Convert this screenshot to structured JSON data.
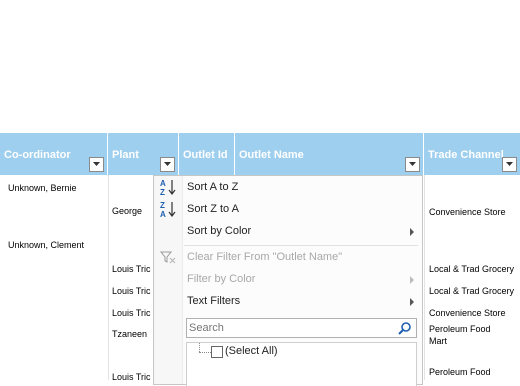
{
  "header": {
    "columns": [
      {
        "label": "Co-ordinator"
      },
      {
        "label": "Plant"
      },
      {
        "label": "Outlet Id"
      },
      {
        "label": "Outlet Name"
      },
      {
        "label": "Trade Channel"
      }
    ]
  },
  "rows": {
    "r1_coord": "Unknown, Bernie",
    "r2_plant": "George",
    "r2_channel": "Convenience Store",
    "r3_coord": "Unknown, Clement",
    "r4_plant": "Louis Tric",
    "r4_channel": "Local & Trad Grocery",
    "r5_plant": "Louis Tric",
    "r5_channel": "Local & Trad Grocery",
    "r6_plant": "Louis Tric",
    "r6_channel": "Convenience Store",
    "r7_plant": "Tzaneen",
    "r7_channel_l1": "Peroleum Food",
    "r7_channel_l2": "Mart",
    "r8_plant": "Louis Tric",
    "r8_channel": "Peroleum Food"
  },
  "filter_menu": {
    "sort_az": "Sort A to Z",
    "sort_za": "Sort Z to A",
    "sort_color": "Sort by Color",
    "clear_filter": "Clear Filter From \"Outlet Name\"",
    "filter_color": "Filter by Color",
    "text_filters": "Text Filters",
    "search_placeholder": "Search",
    "select_all": "(Select All)"
  },
  "colors": {
    "header_bg": "#9fcfef",
    "header_text": "#ffffff"
  }
}
